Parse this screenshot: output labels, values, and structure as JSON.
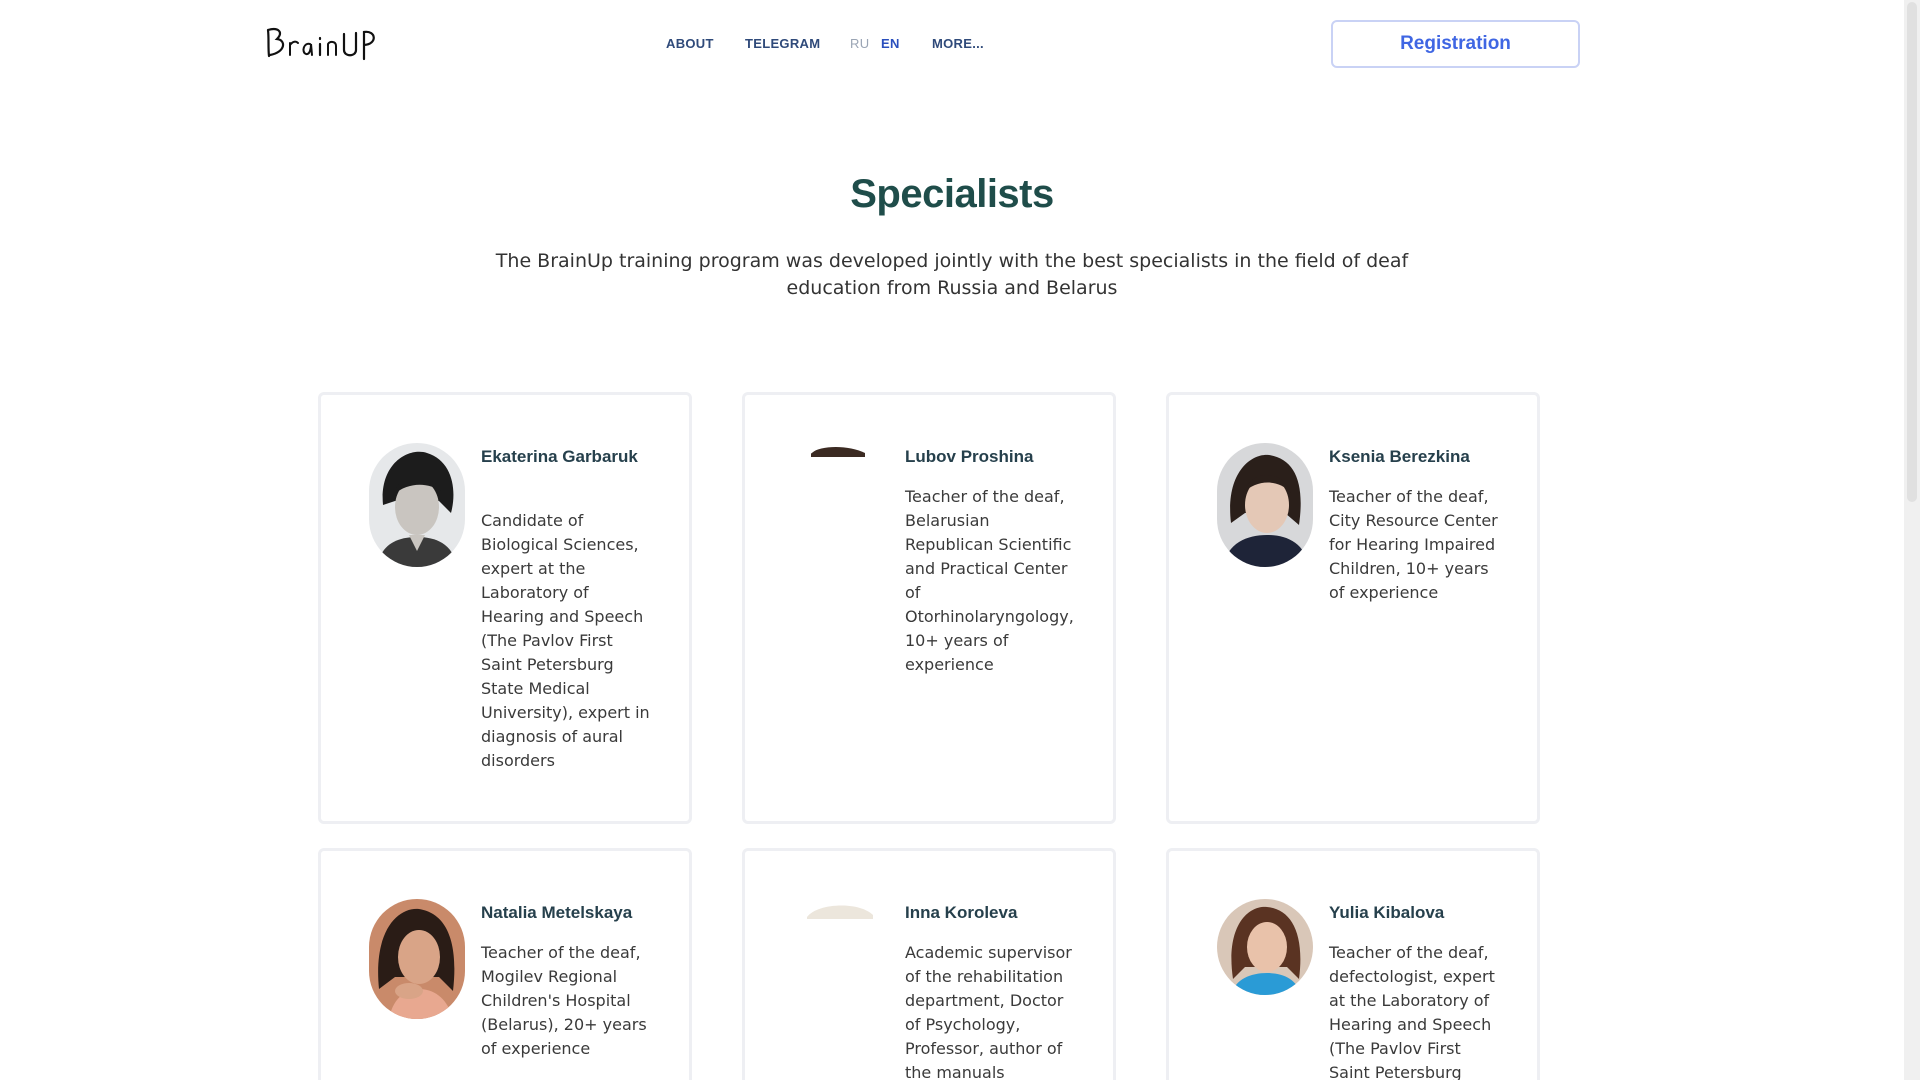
{
  "header": {
    "logo_text": "BrainUP",
    "nav": [
      "ABOUT",
      "TELEGRAM",
      "RU",
      "EN",
      "MORE..."
    ],
    "registration_label": "Registration"
  },
  "main": {
    "title": "Specialists",
    "intro": "The BrainUp training program was developed jointly with the best specialists in the field of deaf education from Russia and Belarus"
  },
  "specialists": [
    {
      "name": "Ekaterina Garbaruk",
      "description": "Candidate of Biological Sciences, expert at the Laboratory of Hearing and Speech (The Pavlov First Saint Petersburg State Medical University), expert in diagnosis of aural disorders"
    },
    {
      "name": "Lubov Proshina",
      "description": "Teacher of the deaf, Belarusian Republican Scientific and Practical Center of Otorhinolaryngology, 10+ years of experience"
    },
    {
      "name": "Ksenia Berezkina",
      "description": "Teacher of the deaf, City Resource Center for Hearing Impaired Children, 10+ years of experience"
    },
    {
      "name": "Natalia Metelskaya",
      "description": "Teacher of the deaf, Mogilev Regional Children's Hospital (Belarus), 20+ years of experience"
    },
    {
      "name": "Inna Koroleva",
      "description": "Academic supervisor of the rehabilitation department, Doctor of Psychology, Professor, author of the manuals"
    },
    {
      "name": "Yulia Kibalova",
      "description": "Teacher of the deaf, defectologist, expert at the Laboratory of Hearing and Speech (The Pavlov First Saint Petersburg"
    }
  ]
}
